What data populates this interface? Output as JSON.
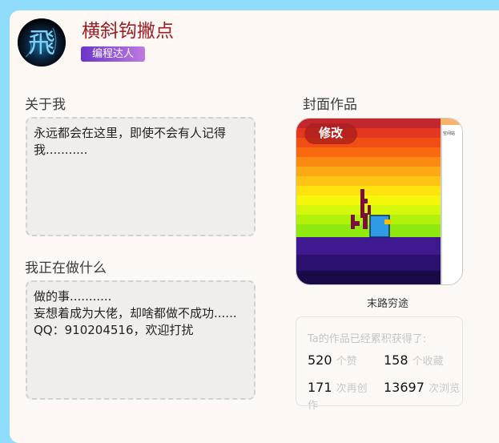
{
  "profile": {
    "username": "横斜钩撇点",
    "badge": "编程达人",
    "avatar_glyph": "飛"
  },
  "about": {
    "title": "关于我",
    "text": "永远都会在这里，即使不会有人记得我..........."
  },
  "doing": {
    "title": "我正在做什么",
    "lines": [
      "做的事...........",
      "妄想着成为大佬，却啥都做不成功......",
      "QQ：910204516，欢迎打扰"
    ]
  },
  "cover": {
    "title": "封面作品",
    "edit_label": "修改",
    "work_title": "末路穷途",
    "side_text": "空间站"
  },
  "stats": {
    "title": "Ta的作品已经累积获得了:",
    "likes": {
      "value": "520",
      "label": "个赞"
    },
    "favorites": {
      "value": "158",
      "label": "个收藏"
    },
    "remixes": {
      "value": "171",
      "label": "次再创作"
    },
    "views": {
      "value": "13697",
      "label": "次浏览"
    }
  }
}
